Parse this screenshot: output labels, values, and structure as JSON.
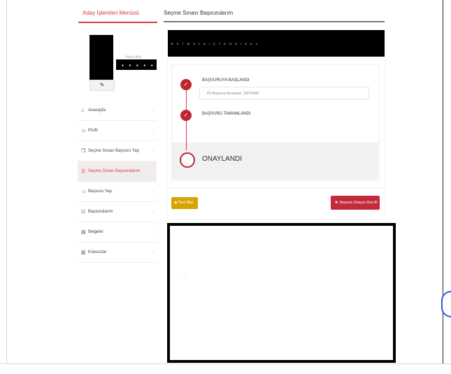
{
  "sidebar": {
    "title": "Aday İşlemleri Menüsü",
    "profile": {
      "name_top": "Mevcutluk",
      "name": "● ●  ●  ●  ●"
    },
    "edit_icon": "pencil-icon",
    "items": [
      {
        "icon": "home-icon",
        "glyph": "⌂",
        "label": "Anasayfa",
        "active": false
      },
      {
        "icon": "user-icon",
        "glyph": "☺",
        "label": "Profil",
        "active": false
      },
      {
        "icon": "clipboard-icon",
        "glyph": "❐",
        "label": "Seçme Sınavı Başvuru Yap",
        "active": false
      },
      {
        "icon": "list-icon",
        "glyph": "☰",
        "label": "Seçme Sınavı Başvurularım",
        "active": true
      },
      {
        "icon": "user-add-icon",
        "glyph": "☺",
        "label": "Başvuru Yap",
        "active": false
      },
      {
        "icon": "grid-icon",
        "glyph": "☷",
        "label": "Başvurularım",
        "active": false
      },
      {
        "icon": "document-icon",
        "glyph": "▤",
        "label": "Belgeler",
        "active": false
      },
      {
        "icon": "book-icon",
        "glyph": "▥",
        "label": "Kılavuzlar",
        "active": false
      }
    ]
  },
  "main": {
    "title": "Seçme Sınavı Başvurularım",
    "banner_text": "B E T M A Y A  İ Ç T E N  S I N A V",
    "steps": [
      {
        "label": "BAŞVURUYA BAŞLANDI",
        "status": "done"
      },
      {
        "label": "BAŞVURU TAMAMLANDI",
        "status": "done"
      },
      {
        "label": "ONAYLANDI",
        "status": "pending"
      }
    ],
    "application_number": "Ön Başvuru Numarası: 20079440",
    "buttons": {
      "view": "Özet Bilgi",
      "revoke": "Başvuru Onayını Geri Al"
    }
  },
  "colors": {
    "accent": "#d23a47",
    "step": "#c0262f",
    "view": "#d6a400",
    "revoke": "#c42b3a"
  }
}
